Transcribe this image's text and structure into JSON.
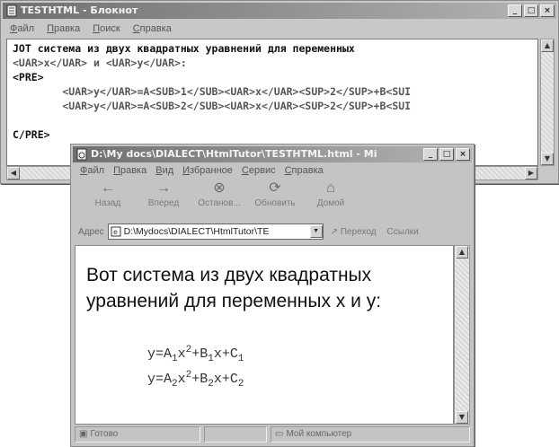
{
  "notepad": {
    "title": "TESTHTML - Блокнот",
    "menu": [
      "Файл",
      "Правка",
      "Поиск",
      "Справка"
    ],
    "lines": [
      "ЈОТ система из двух квадратных уравнений для переменных",
      "<UAR>x</UAR> и <UAR>y</UAR>:",
      "<PRE>",
      "        <UAR>y</UAR>=A<SUB>1</SUB><UAR>x</UAR><SUP>2</SUP>+B<SUI",
      "        <UAR>y</UAR>=A<SUB>2</SUB><UAR>x</UAR><SUP>2</SUP>+B<SUI",
      "",
      "C/PRE>"
    ]
  },
  "browser": {
    "title": "D:\\My docs\\DIALECT\\HtmlTutor\\TESTHTML.html - Mi",
    "menu": [
      "Файл",
      "Правка",
      "Вид",
      "Избранное",
      "Сервис",
      "Справка"
    ],
    "toolbar": [
      {
        "label": "Назад",
        "icon": "back-arrow-icon",
        "glyph": "←"
      },
      {
        "label": "Вперед",
        "icon": "forward-arrow-icon",
        "glyph": "→"
      },
      {
        "label": "Останов...",
        "icon": "stop-icon",
        "glyph": "⊗"
      },
      {
        "label": "Обновить",
        "icon": "refresh-icon",
        "glyph": "⟳"
      },
      {
        "label": "Домой",
        "icon": "home-icon",
        "glyph": "⌂"
      }
    ],
    "address": {
      "label": "Адрес",
      "value": "D:\\Mydocs\\DIALECT\\HtmlTutor\\TE",
      "go_label": "Переход",
      "links_label": "Ссылки"
    },
    "content": {
      "paragraph": "Вот система из двух квадратных уравнений для переменных x и y:",
      "formula1": {
        "lhs": "y=A",
        "sub_a": "1",
        "x": "x",
        "sup": "2",
        "plus_b": "+B",
        "sub_b": "1",
        "x2": "x+C",
        "sub_c": "1"
      },
      "formula2": {
        "lhs": "y=A",
        "sub_a": "2",
        "x": "x",
        "sup": "2",
        "plus_b": "+B",
        "sub_b": "2",
        "x2": "x+C",
        "sub_c": "2"
      }
    },
    "status": {
      "ready": "Готово",
      "zone": "Мой компьютер"
    }
  }
}
